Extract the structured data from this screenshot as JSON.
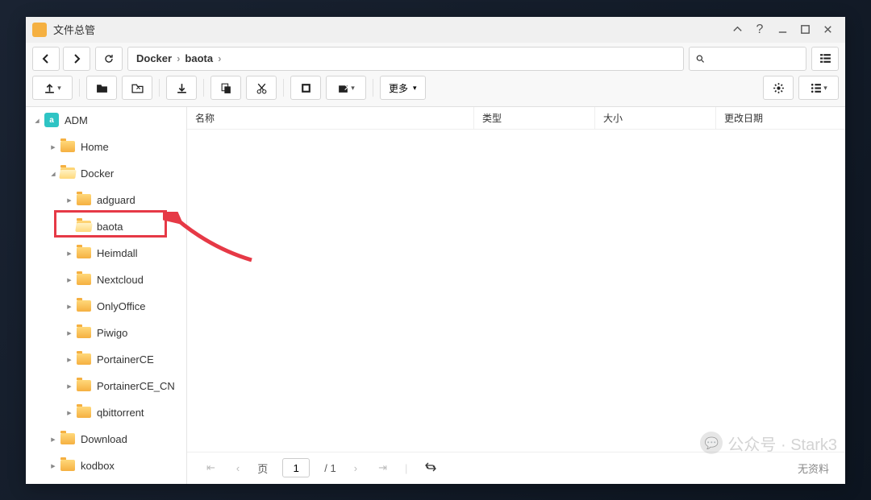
{
  "window": {
    "title": "文件总管"
  },
  "breadcrumb": {
    "segments": [
      "Docker",
      "baota"
    ]
  },
  "toolbar": {
    "more_label": "更多"
  },
  "columns": {
    "name": "名称",
    "type": "类型",
    "size": "大小",
    "date": "更改日期"
  },
  "tree": {
    "root": "ADM",
    "items": [
      {
        "label": "Home",
        "level": 1,
        "open": false,
        "expander": "collapsed"
      },
      {
        "label": "Docker",
        "level": 1,
        "open": true,
        "expander": "expanded"
      },
      {
        "label": "adguard",
        "level": 2,
        "open": false,
        "expander": "collapsed"
      },
      {
        "label": "baota",
        "level": 2,
        "open": true,
        "expander": "none",
        "highlighted": true
      },
      {
        "label": "Heimdall",
        "level": 2,
        "open": false,
        "expander": "collapsed"
      },
      {
        "label": "Nextcloud",
        "level": 2,
        "open": false,
        "expander": "collapsed"
      },
      {
        "label": "OnlyOffice",
        "level": 2,
        "open": false,
        "expander": "collapsed"
      },
      {
        "label": "Piwigo",
        "level": 2,
        "open": false,
        "expander": "collapsed"
      },
      {
        "label": "PortainerCE",
        "level": 2,
        "open": false,
        "expander": "collapsed"
      },
      {
        "label": "PortainerCE_CN",
        "level": 2,
        "open": false,
        "expander": "collapsed"
      },
      {
        "label": "qbittorrent",
        "level": 2,
        "open": false,
        "expander": "collapsed"
      },
      {
        "label": "Download",
        "level": 1,
        "open": false,
        "expander": "collapsed"
      },
      {
        "label": "kodbox",
        "level": 1,
        "open": false,
        "expander": "collapsed"
      }
    ]
  },
  "pager": {
    "label_page": "页",
    "current": "1",
    "total": "/ 1",
    "no_data": "无资料"
  },
  "watermark": {
    "text": "公众号 · Stark3"
  }
}
